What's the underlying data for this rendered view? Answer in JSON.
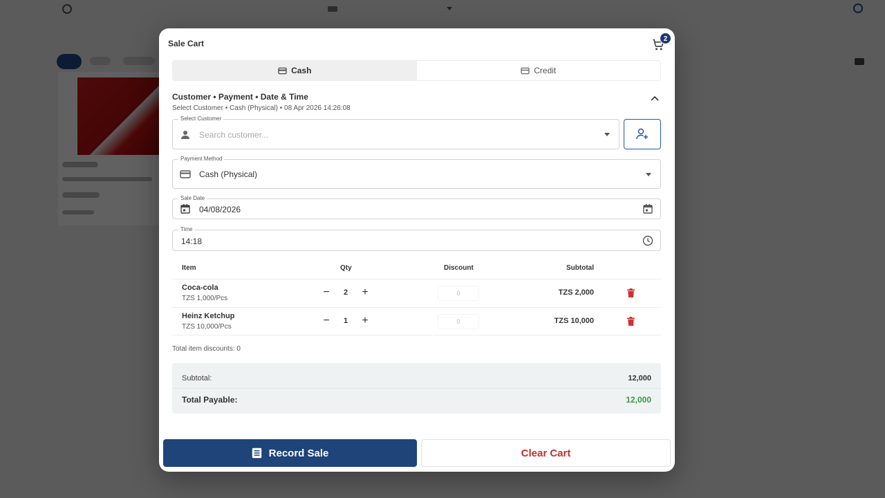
{
  "modal": {
    "title": "Sale Cart",
    "cart_count": "2"
  },
  "tabs": [
    {
      "label": "Cash",
      "active": true,
      "icon": "wallet-icon"
    },
    {
      "label": "Credit",
      "active": false,
      "icon": "credit-card-icon"
    }
  ],
  "section": {
    "title": "Customer • Payment • Date & Time",
    "summary": "Select Customer • Cash (Physical) • 08 Apr 2026 14:26:08"
  },
  "fields": {
    "customer": {
      "label": "Select Customer",
      "placeholder": "Search customer..."
    },
    "payment": {
      "label": "Payment Method",
      "value": "Cash (Physical)"
    },
    "date": {
      "label": "Sale Date",
      "value": "04/08/2026"
    },
    "time": {
      "label": "Time",
      "value": "14:18"
    }
  },
  "table": {
    "headers": {
      "item": "Item",
      "qty": "Qty",
      "discount": "Discount",
      "subtotal": "Subtotal"
    },
    "rows": [
      {
        "name": "Coca-cola",
        "price": "TZS 1,000/Pcs",
        "qty": "2",
        "discount": "0",
        "subtotal": "TZS 2,000"
      },
      {
        "name": "Heinz Ketchup",
        "price": "TZS 10,000/Pcs",
        "qty": "1",
        "discount": "0",
        "subtotal": "TZS 10,000"
      }
    ],
    "total_discounts": "Total item discounts: 0"
  },
  "summary": {
    "subtotal_label": "Subtotal:",
    "subtotal_value": "12,000",
    "payable_label": "Total Payable:",
    "payable_value": "12,000"
  },
  "buttons": {
    "record": "Record Sale",
    "clear": "Clear Cart"
  },
  "colors": {
    "primary": "#1e447a",
    "danger": "#c0302b",
    "success": "#3a9a46",
    "badge": "#1e3a6e"
  }
}
